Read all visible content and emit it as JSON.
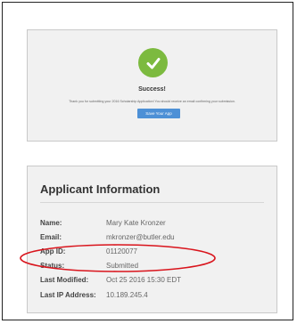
{
  "success": {
    "title": "Success!",
    "message": "Thank you for submitting your 2016 Scholarship Application! You should receive an email confirming your submission.",
    "button_label": "Save Your App",
    "check_color": "#7cba3f",
    "button_color": "#4d90d6"
  },
  "applicant": {
    "title": "Applicant Information",
    "rows": [
      {
        "label": "Name:",
        "value": "Mary Kate Kronzer"
      },
      {
        "label": "Email:",
        "value": "mkronzer@butler.edu"
      },
      {
        "label": "App ID:",
        "value": "01120077"
      },
      {
        "label": "Status:",
        "value": "Submitted"
      },
      {
        "label": "Last Modified:",
        "value": "Oct 25 2016 15:30 EDT"
      },
      {
        "label": "Last IP Address:",
        "value": "10.189.245.4"
      }
    ]
  },
  "annotation": {
    "color": "#d9141c",
    "icon": "red-ellipse-highlight"
  }
}
